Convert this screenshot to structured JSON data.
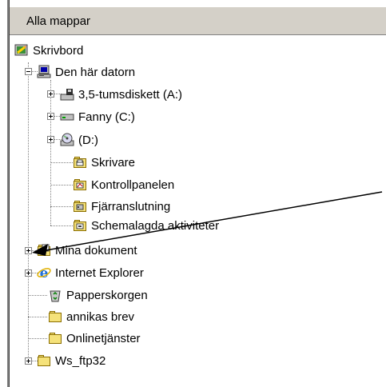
{
  "header": {
    "title": "Alla mappar"
  },
  "tree": {
    "desktop": "Skrivbord",
    "computer": "Den här datorn",
    "floppy": "3,5-tumsdiskett (A:)",
    "drive_c": "Fanny (C:)",
    "drive_d": "(D:)",
    "printers": "Skrivare",
    "control_panel": "Kontrollpanelen",
    "dialup": "Fjärranslutning",
    "scheduled": "Schemalagda aktiviteter",
    "my_documents": "Mina dokument",
    "ie": "Internet Explorer",
    "recycle": "Papperskorgen",
    "annikas": "annikas brev",
    "online": "Onlinetjänster",
    "wsftp": "Ws_ftp32"
  },
  "colors": {
    "header_bg": "#d4d0c8",
    "folder": "#f5e27a",
    "ie_blue": "#1e6fd9",
    "arrow": "#000000"
  }
}
